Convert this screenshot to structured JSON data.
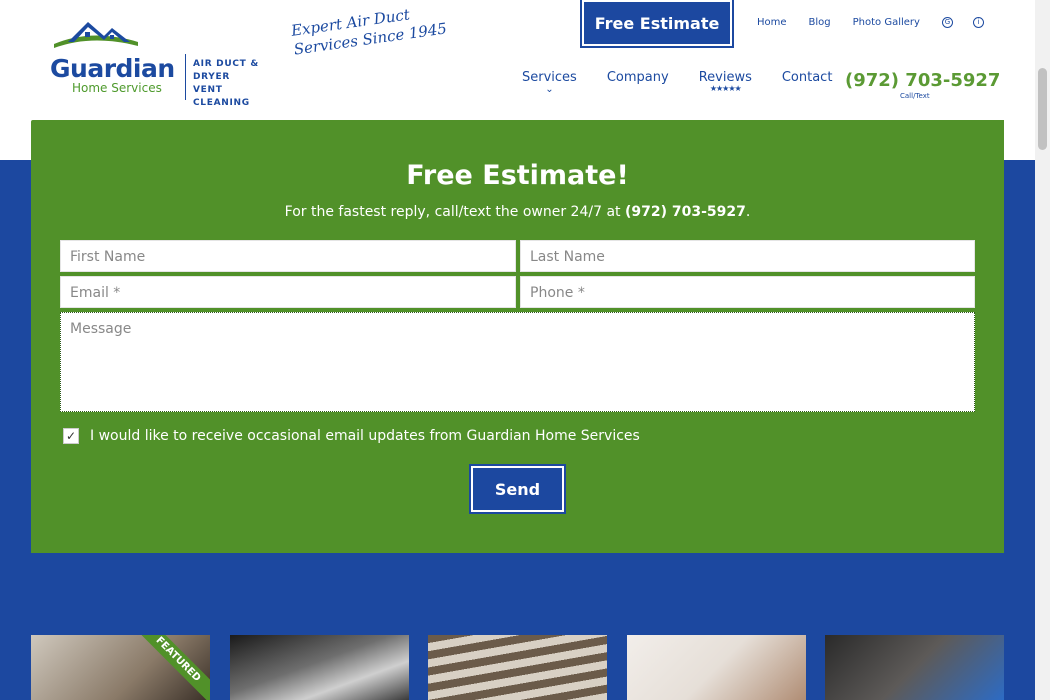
{
  "header": {
    "logo": {
      "name": "Guardian",
      "sub": "Home Services",
      "tag_lines": [
        "AIR DUCT &",
        "DRYER VENT",
        "CLEANING"
      ]
    },
    "tagline_lines": [
      "Expert Air Duct",
      "Services Since 1945"
    ],
    "estimate_button": "Free Estimate",
    "topnav": {
      "home": "Home",
      "blog": "Blog",
      "gallery": "Photo Gallery"
    },
    "nav": {
      "services": "Services",
      "company": "Company",
      "reviews": "Reviews",
      "reviews_stars": "★★★★★",
      "contact": "Contact"
    },
    "phone": "(972) 703-5927",
    "phone_sub": "Call/Text"
  },
  "form": {
    "title": "Free Estimate!",
    "subtitle_prefix": "For the fastest reply, call/text the owner 24/7 at ",
    "subtitle_phone": "(972) 703-5927",
    "subtitle_suffix": ".",
    "first_name": "First Name",
    "last_name": "Last Name",
    "email": "Email *",
    "phone": "Phone *",
    "message": "Message",
    "consent_checked": true,
    "consent_label": "I would like to receive occasional email updates from Guardian Home Services",
    "send": "Send"
  },
  "cards": [
    {
      "ribbon": "FEATURED"
    }
  ],
  "colors": {
    "brand_blue": "#1c48a0",
    "brand_green": "#519129"
  }
}
